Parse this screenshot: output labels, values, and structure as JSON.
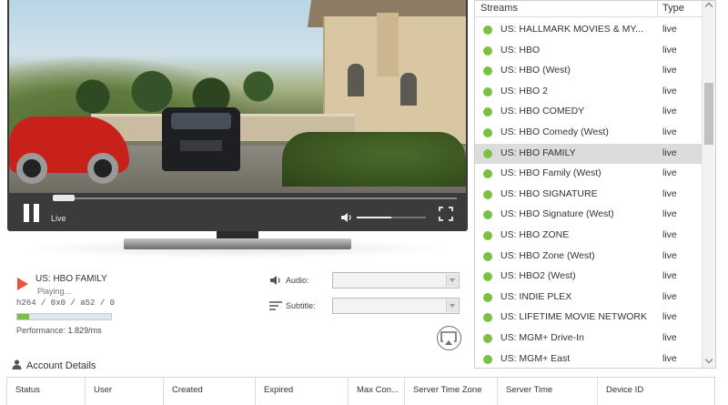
{
  "player": {
    "live_label": "Live",
    "progress": 0.05,
    "volume": 0.5
  },
  "now_playing": {
    "channel": "US: HBO FAMILY",
    "status": "Playing...",
    "codec": "h264 / 0x0 / a52  / 0",
    "performance_label": "Performance:",
    "performance_value": "1.829/ms",
    "performance_fill": 0.13
  },
  "audio": {
    "label": "Audio:",
    "value": ""
  },
  "subtitle": {
    "label": "Subtitle:",
    "value": ""
  },
  "account": {
    "title": "Account Details",
    "columns": [
      "Status",
      "User",
      "Created",
      "Expired",
      "Max Con...",
      "Server Time Zone",
      "Server Time",
      "Device ID"
    ]
  },
  "streams": {
    "header_streams": "Streams",
    "header_type": "Type",
    "status_color": "#7bc043",
    "items": [
      {
        "name": "US: HALLMARK MOVIES & MY...",
        "type": "live",
        "selected": false
      },
      {
        "name": "US: HBO",
        "type": "live",
        "selected": false
      },
      {
        "name": "US: HBO (West)",
        "type": "live",
        "selected": false
      },
      {
        "name": "US: HBO 2",
        "type": "live",
        "selected": false
      },
      {
        "name": "US: HBO COMEDY",
        "type": "live",
        "selected": false
      },
      {
        "name": "US: HBO Comedy (West)",
        "type": "live",
        "selected": false
      },
      {
        "name": "US: HBO FAMILY",
        "type": "live",
        "selected": true
      },
      {
        "name": "US: HBO Family (West)",
        "type": "live",
        "selected": false
      },
      {
        "name": "US: HBO SIGNATURE",
        "type": "live",
        "selected": false
      },
      {
        "name": "US: HBO Signature (West)",
        "type": "live",
        "selected": false
      },
      {
        "name": "US: HBO ZONE",
        "type": "live",
        "selected": false
      },
      {
        "name": "US: HBO Zone (West)",
        "type": "live",
        "selected": false
      },
      {
        "name": "US: HBO2 (West)",
        "type": "live",
        "selected": false
      },
      {
        "name": "US: INDIE PLEX",
        "type": "live",
        "selected": false
      },
      {
        "name": "US: LIFETIME MOVIE NETWORK",
        "type": "live",
        "selected": false
      },
      {
        "name": "US: MGM+ Drive-In",
        "type": "live",
        "selected": false
      },
      {
        "name": "US: MGM+ East",
        "type": "live",
        "selected": false
      }
    ]
  }
}
